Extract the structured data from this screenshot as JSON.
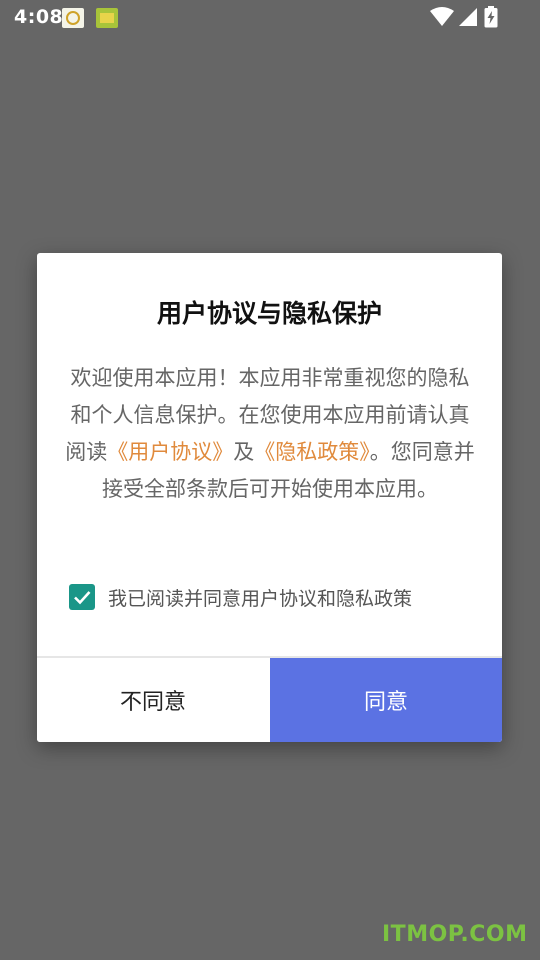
{
  "status_bar": {
    "time": "4:08",
    "notification_icons": [
      "app-notification-icon",
      "app-notification-icon"
    ],
    "system_icons": [
      "wifi-icon",
      "signal-icon",
      "battery-charging-icon"
    ]
  },
  "dialog": {
    "title": "用户协议与隐私保护",
    "body_part1": "欢迎使用本应用！本应用非常重视您的隐私和个人信息保护。在您使用本应用前请认真阅读",
    "user_agreement_link": "《用户协议》",
    "body_and": "及",
    "privacy_policy_link": "《隐私政策》",
    "body_part2": "。您同意并接受全部条款后可开始使用本应用。",
    "consent_checked": true,
    "consent_label": "我已阅读并同意用户协议和隐私政策",
    "disagree_label": "不同意",
    "agree_label": "同意"
  },
  "watermark": "ITMOP.COM",
  "colors": {
    "backdrop": "#666666",
    "accent_button": "#5b72e3",
    "checkbox": "#1a9688",
    "link": "#e08a3c",
    "watermark": "#7cc242"
  }
}
